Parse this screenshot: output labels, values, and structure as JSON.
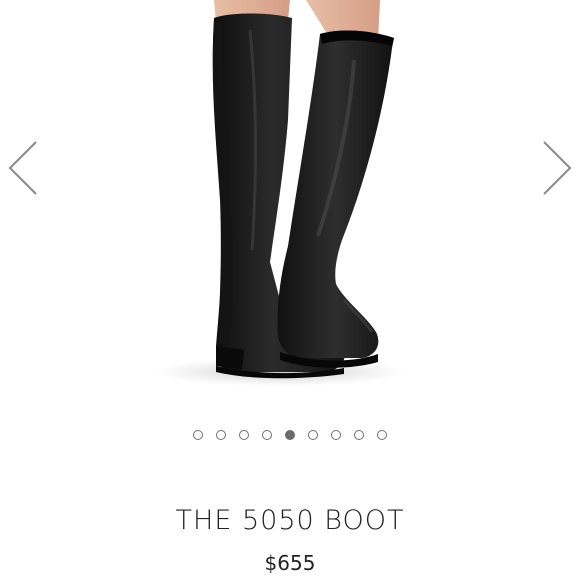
{
  "carousel": {
    "image_subject": "over-the-knee black leather boots",
    "prev_icon": "chevron-left-icon",
    "next_icon": "chevron-right-icon",
    "slide_count": 9,
    "active_slide": 5
  },
  "product": {
    "title": "THE 5050 BOOT",
    "price": "$655"
  },
  "colors": {
    "boot": "#1a1a1a",
    "arrow": "#8a8a8a",
    "dot_border": "#6f6f6f",
    "dot_active": "#6b6b6b",
    "text": "#222222"
  }
}
